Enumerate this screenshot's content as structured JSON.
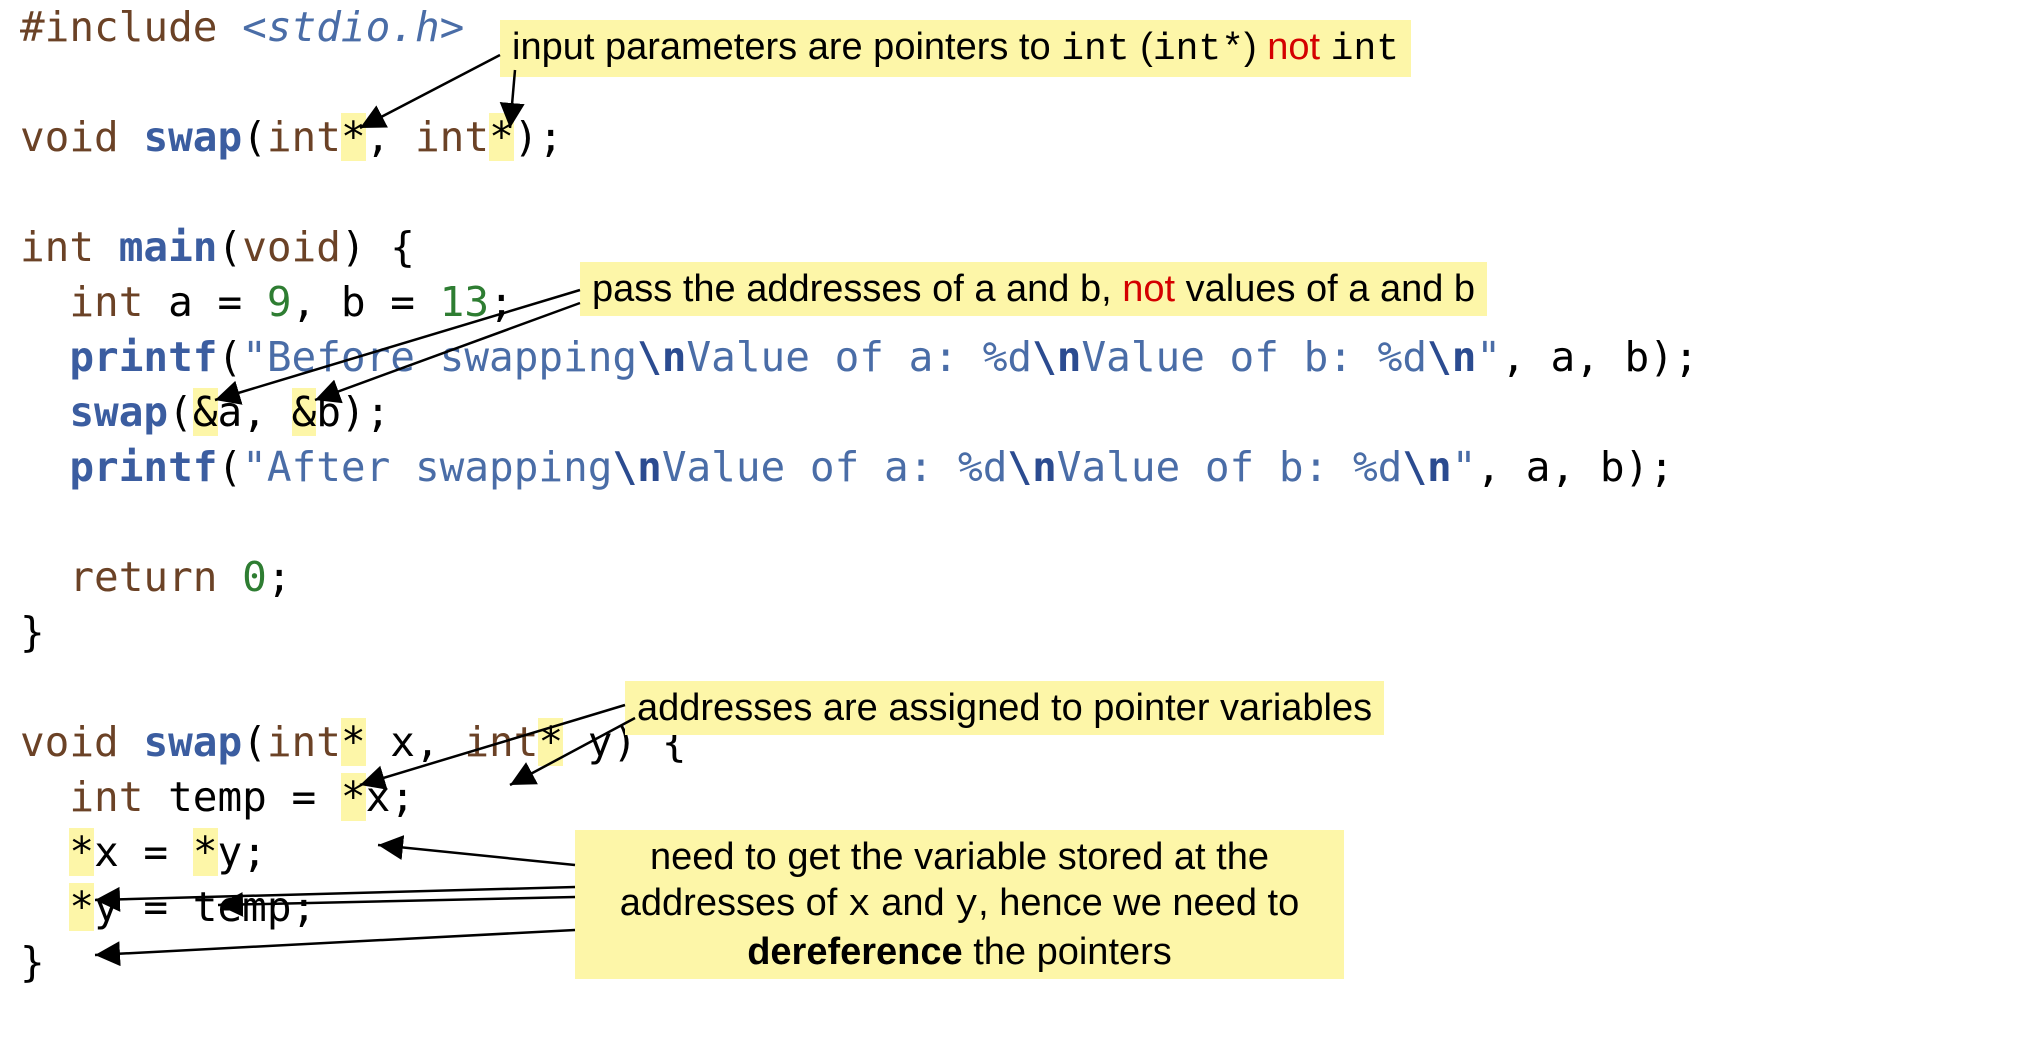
{
  "code": {
    "l1_include": "#include",
    "l1_header": "<stdio.h>",
    "l3_void": "void",
    "l3_swap": "swap",
    "l3_int1": "int",
    "l3_star": "*",
    "l3_sep": ", ",
    "l3_int2": "int",
    "l3_end": ");",
    "l5_int": "int",
    "l5_main": "main",
    "l5_void": "void",
    "l5_brace": ") {",
    "l6_int": "int",
    "l6_a": " a = ",
    "l6_9": "9",
    "l6_sep": ", b = ",
    "l6_13": "13",
    "l6_semi": ";",
    "l7_printf": "printf",
    "l7_open": "(",
    "l7_str1a": "\"Before swapping",
    "l7_esc1": "\\n",
    "l7_str1b": "Value of a: %d",
    "l7_esc2": "\\n",
    "l7_str1c": "Value of b: %d",
    "l7_esc3": "\\n",
    "l7_strend": "\"",
    "l7_args": ", a, b);",
    "l8_swap": "swap",
    "l8_mid": "a, ",
    "l8_end": "b);",
    "l8_amp": "&",
    "l9_printf": "printf",
    "l9_open": "(",
    "l9_str1a": "\"After swapping",
    "l9_esc1": "\\n",
    "l9_str1b": "Value of a: %d",
    "l9_esc2": "\\n",
    "l9_str1c": "Value of b: %d",
    "l9_esc3": "\\n",
    "l9_strend": "\"",
    "l9_args": ", a, b);",
    "l11_return": "return",
    "l11_zero": "0",
    "l11_semi": ";",
    "l12_brace": "}",
    "l14_void": "void",
    "l14_swap": "swap",
    "l14_int1": "int",
    "l14_x": " x, ",
    "l14_int2": "int",
    "l14_y": " y) {",
    "l15_int": "int",
    "l15_temp": " temp = ",
    "l15_x": "x;",
    "l16_x": "x = ",
    "l16_y": "y;",
    "l17_y": "y = temp;",
    "l18_brace": "}",
    "star": "*"
  },
  "callouts": {
    "c1_a": "input parameters are pointers to ",
    "c1_int": "int",
    "c1_b": " (",
    "c1_intstar": "int*",
    "c1_c": ") ",
    "c1_not": "not",
    "c1_d": " ",
    "c1_int2": "int",
    "c2_a": "pass the addresses of a and b, ",
    "c2_not": "not",
    "c2_b": " values of a and b",
    "c3": "addresses are assigned to pointer variables",
    "c4_a": "need to get the variable stored at the",
    "c4_b": "addresses of ",
    "c4_x": "x",
    "c4_c": " and ",
    "c4_y": "y",
    "c4_d": ", hence we need to",
    "c4_e": "dereference",
    "c4_f": " the pointers"
  }
}
